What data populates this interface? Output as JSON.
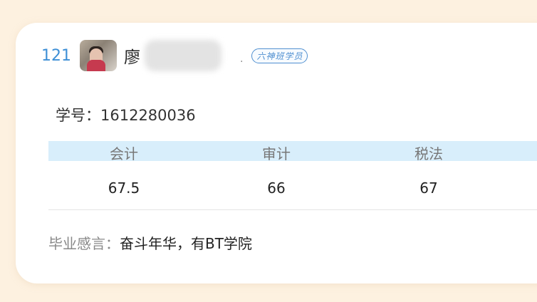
{
  "student": {
    "rank": "121",
    "name_visible": "廖",
    "name_separator": ".",
    "badge": "六神班学员",
    "id_label": "学号：",
    "id_value": "1612280036"
  },
  "scores": {
    "subjects": [
      "会计",
      "审计",
      "税法"
    ],
    "values": [
      "67.5",
      "66",
      "67"
    ]
  },
  "motto": {
    "label": "毕业感言：",
    "text": "奋斗年华，有BT学院"
  },
  "colors": {
    "background": "#fdf1e0",
    "card": "#ffffff",
    "accent_blue": "#3d8fd6",
    "header_band": "#d8eefb"
  },
  "icons": {
    "avatar": "avatar-photo"
  }
}
